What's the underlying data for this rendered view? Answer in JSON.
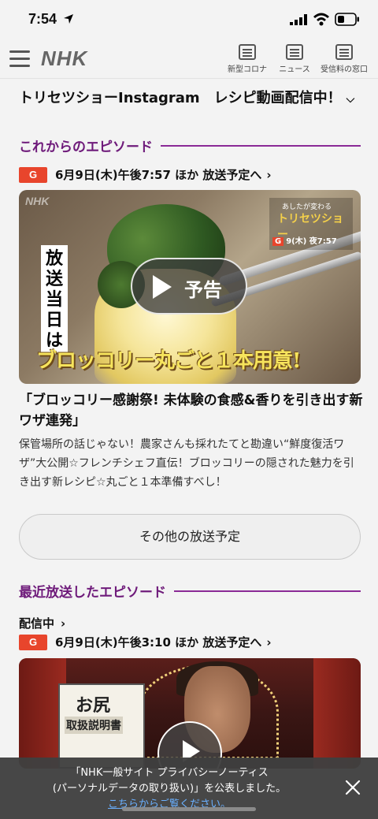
{
  "status_bar": {
    "time": "7:54"
  },
  "header": {
    "logo": "NHK",
    "nav": [
      {
        "label": "新型コロナ"
      },
      {
        "label": "ニュース"
      },
      {
        "label": "受信料の窓口"
      }
    ]
  },
  "top_link": {
    "text": "トリセツショーInstagram　レシピ動画配信中！"
  },
  "upcoming": {
    "section_title": "これからのエピソード",
    "channel": "G",
    "broadcast_text": "6月9日(木)午後7:57 ほか 放送予定へ",
    "video": {
      "logo": "NHK",
      "vertical_text": "放送当日は",
      "caption": "ブロッコリー丸ごと１本用意!",
      "show_small": "あしたが変わる",
      "show_name": "トリセツショー",
      "show_channel": "G",
      "show_time": "9(木) 夜7:57",
      "play_label": "予告"
    },
    "title": "「ブロッコリー感謝祭! 未体験の食感&香りを引き出す新ワザ連発」",
    "description": "保管場所の話じゃない！農家さんも採れたてと勘違い“鮮度復活ワザ”大公開☆フレンチシェフ直伝！ブロッコリーの隠された魅力を引き出す新レシピ☆丸ごと１本準備すべし！"
  },
  "other_button": {
    "label": "その他の放送予定"
  },
  "recent": {
    "section_title": "最近放送したエピソード",
    "stream_link": "配信中",
    "channel": "G",
    "broadcast_text": "6月9日(木)午後3:10 ほか 放送予定へ",
    "video": {
      "sign_line1": "お尻",
      "sign_line2": "取扱説明書"
    }
  },
  "notice": {
    "line1": "「NHK一般サイト プライバシーノーティス",
    "line2": "(パーソナルデータの取り扱い)」を公表しました。",
    "link": "こちらからご覧ください。"
  }
}
